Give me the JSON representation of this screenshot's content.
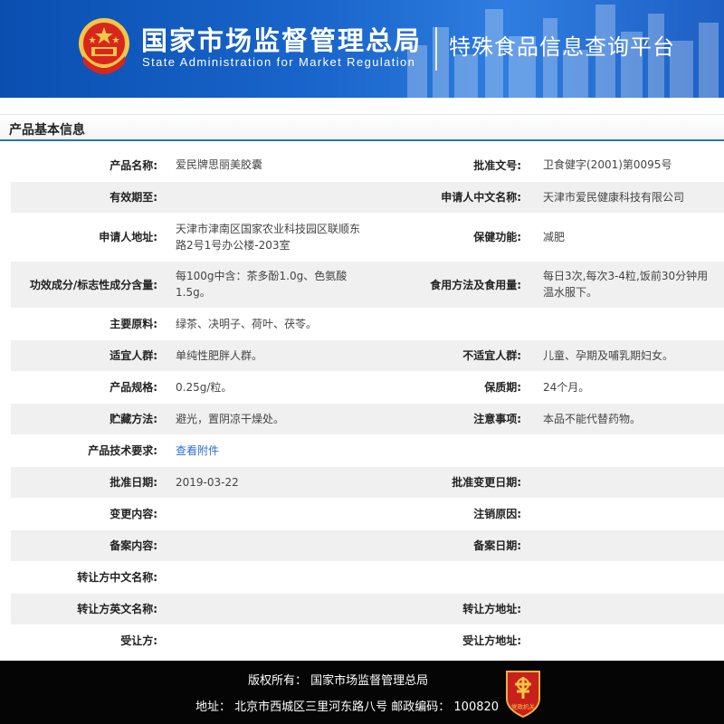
{
  "header": {
    "agency_cn": "国家市场监督管理总局",
    "agency_en": "State Administration  for  Market Regulation",
    "platform": "特殊食品信息查询平台"
  },
  "section": {
    "title": "产品基本信息"
  },
  "rows": [
    {
      "label1": "产品名称:",
      "value1": "爱民牌思丽美胶囊",
      "label2": "批准文号:",
      "value2": "卫食健字(2001)第0095号"
    },
    {
      "label1": "有效期至:",
      "value1": "",
      "label2": "申请人中文名称:",
      "value2": "天津市爱民健康科技有限公司"
    },
    {
      "label1": "申请人地址:",
      "value1": "天津市津南区国家农业科技园区联顺东路2号1号办公楼-203室",
      "label2": "保健功能:",
      "value2": "减肥"
    },
    {
      "label1": "功效成分/标志性成分含量:",
      "value1": "每100g中含：茶多酚1.0g、色氨酸1.5g。",
      "label2": "食用方法及食用量:",
      "value2": "每日3次,每次3-4粒,饭前30分钟用温水服下。"
    },
    {
      "label1": "主要原料:",
      "value1": "绿茶、决明子、荷叶、茯苓。",
      "label2": "",
      "value2": ""
    },
    {
      "label1": "适宜人群:",
      "value1": "单纯性肥胖人群。",
      "label2": "不适宜人群:",
      "value2": "儿童、孕期及哺乳期妇女。"
    },
    {
      "label1": "产品规格:",
      "value1": "0.25g/粒。",
      "label2": "保质期:",
      "value2": "24个月。"
    },
    {
      "label1": "贮藏方法:",
      "value1": "避光，置阴凉干燥处。",
      "label2": "注意事项:",
      "value2": "本品不能代替药物。"
    },
    {
      "label1": "产品技术要求:",
      "value1": "查看附件",
      "label2": "",
      "value2": ""
    },
    {
      "label1": "批准日期:",
      "value1": "2019-03-22",
      "label2": "批准变更日期:",
      "value2": ""
    },
    {
      "label1": "变更内容:",
      "value1": "",
      "label2": "注销原因:",
      "value2": ""
    },
    {
      "label1": "备案内容:",
      "value1": "",
      "label2": "备案日期:",
      "value2": ""
    },
    {
      "label1": "转让方中文名称:",
      "value1": "",
      "label2": "",
      "value2": ""
    },
    {
      "label1": "转让方英文名称:",
      "value1": "",
      "label2": "转让方地址:",
      "value2": ""
    },
    {
      "label1": "受让方:",
      "value1": "",
      "label2": "受让方地址:",
      "value2": ""
    }
  ],
  "footer": {
    "copyright": "版权所有：  国家市场监督管理总局",
    "address": "地址：  北京市西城区三里河东路八号  邮政编码：  100820",
    "badge_text": "党政机关"
  },
  "colors": {
    "header_blue": "#1a66cc",
    "link_blue": "#2a6fd1",
    "row_alt": "#f0f0f0",
    "footer_bg": "#050505",
    "emblem_red": "#d7261e",
    "emblem_gold": "#f6c648"
  },
  "icons": {
    "emblem": "national-emblem-icon",
    "badge": "gov-org-badge-icon"
  }
}
